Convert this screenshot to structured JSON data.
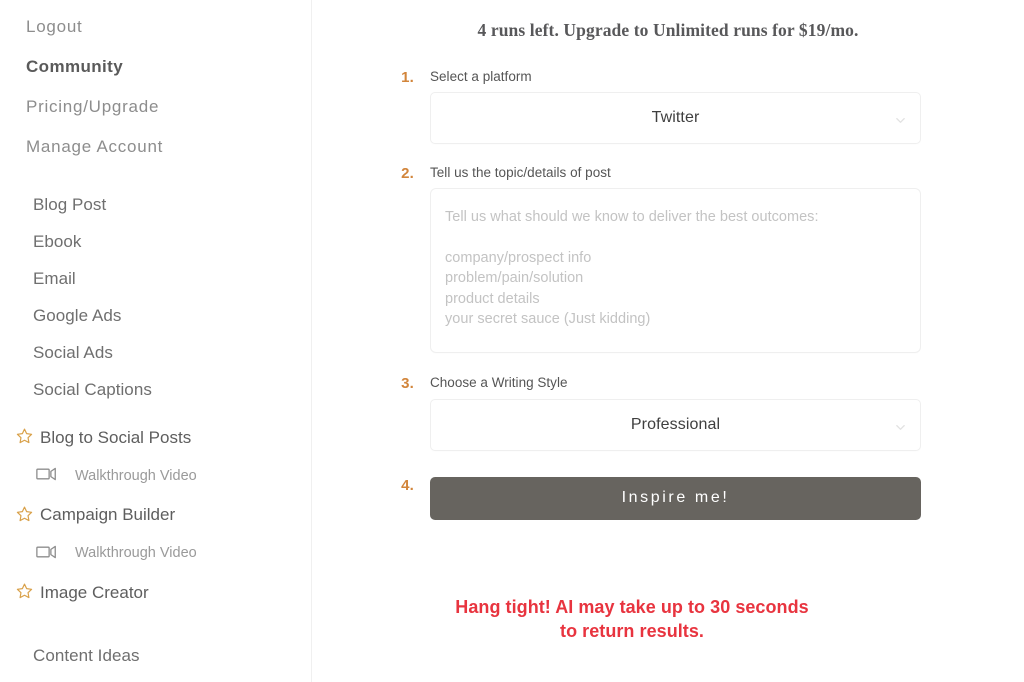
{
  "sidebar": {
    "account_items": [
      {
        "label": "Logout",
        "active": false
      },
      {
        "label": "Community",
        "active": true
      },
      {
        "label": "Pricing/Upgrade",
        "active": false
      },
      {
        "label": "Manage Account",
        "active": false
      }
    ],
    "tool_items": [
      {
        "label": "Blog Post"
      },
      {
        "label": "Ebook"
      },
      {
        "label": "Email"
      },
      {
        "label": "Google Ads"
      },
      {
        "label": "Social Ads"
      },
      {
        "label": "Social Captions"
      }
    ],
    "featured_items": [
      {
        "label": "Blog to Social Posts",
        "icon": "star-icon",
        "sub": {
          "label": "Walkthrough Video",
          "icon": "video-camera-icon"
        }
      },
      {
        "label": "Campaign Builder",
        "icon": "star-icon",
        "sub": {
          "label": "Walkthrough Video",
          "icon": "video-camera-icon"
        }
      },
      {
        "label": "Image Creator",
        "icon": "star-icon",
        "sub": null
      }
    ],
    "footer_items": [
      {
        "label": "Content Ideas"
      }
    ]
  },
  "main": {
    "runs_banner": "4 runs left. Upgrade to Unlimited runs for $19/mo.",
    "steps": {
      "one": "1.",
      "two": "2.",
      "three": "3.",
      "four": "4."
    },
    "platform": {
      "label": "Select a platform",
      "value": "Twitter",
      "options": [
        "Twitter"
      ]
    },
    "topic": {
      "label": "Tell us the topic/details of post",
      "value": "",
      "placeholder_lines": [
        "Tell us what should we know to deliver the best outcomes:",
        "company/prospect info",
        "problem/pain/solution",
        "product details",
        "your secret sauce (Just kidding)"
      ],
      "placeholder": "Tell us what should we know to deliver the best outcomes:\n\ncompany/prospect info\nproblem/pain/solution\nproduct details\nyour secret sauce (Just kidding)"
    },
    "writing_style": {
      "label": "Choose a Writing Style",
      "value": "Professional",
      "options": [
        "Professional"
      ]
    },
    "submit": {
      "label": "Inspire me!"
    },
    "notice": {
      "line1": "Hang tight! AI may take up to 30 seconds",
      "line2": "to return results."
    }
  },
  "colors": {
    "accent_orange": "#d2853b",
    "star_gold": "#d9a14a",
    "notice_red": "#e8343f",
    "button_gray": "#67645f",
    "divider": "#f0f0f0"
  }
}
